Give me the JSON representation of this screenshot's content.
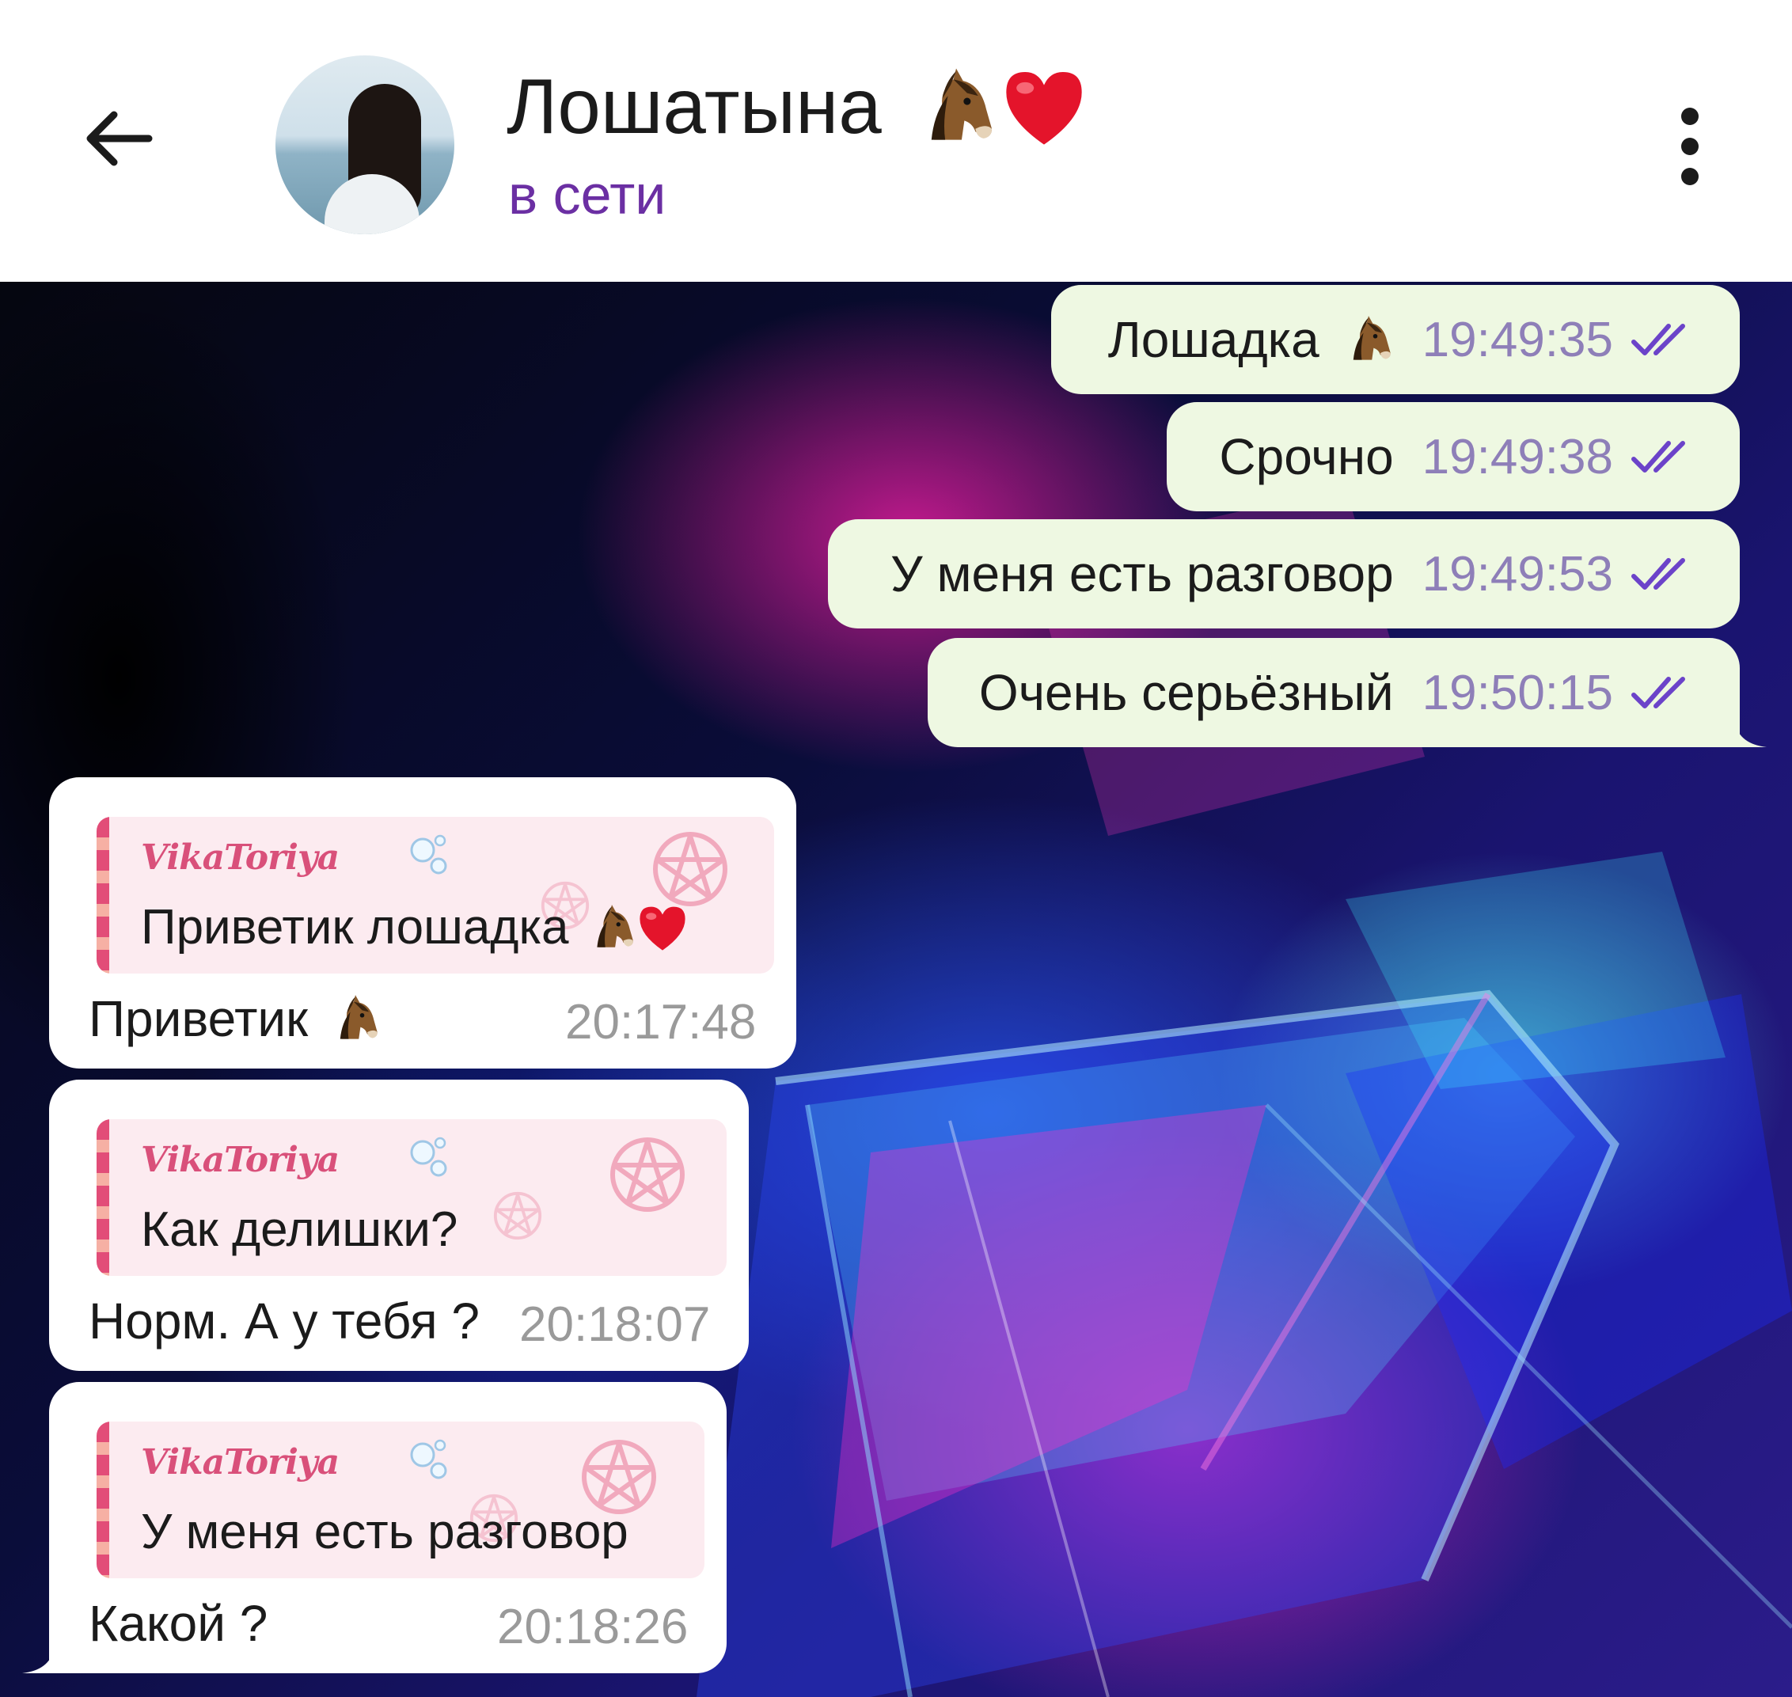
{
  "header": {
    "contact_name": "Лошатына",
    "name_emoji": [
      "horse-face-icon",
      "red-heart-icon"
    ],
    "status": "в сети",
    "status_color": "#6b2fa3"
  },
  "outgoing": [
    {
      "text": "Лошадка",
      "emoji": "horse-face-icon",
      "time": "19:49:35"
    },
    {
      "text": "Срочно",
      "time": "19:49:38"
    },
    {
      "text": "У меня есть разговор",
      "time": "19:49:53"
    },
    {
      "text": "Очень серьёзный",
      "time": "19:50:15"
    }
  ],
  "incoming": [
    {
      "quote_author": "VikaToriya",
      "quote_text": "Приветик лошадка",
      "quote_emoji": [
        "horse-face-icon",
        "red-heart-icon"
      ],
      "text": "Приветик",
      "emoji": "horse-face-icon",
      "time": "20:17:48"
    },
    {
      "quote_author": "VikaToriya",
      "quote_text": "Как делишки?",
      "text": "Норм. А у тебя ?",
      "time": "20:18:07"
    },
    {
      "quote_author": "VikaToriya",
      "quote_text": "У меня есть разговор",
      "text": "Какой ?",
      "time": "20:18:26"
    }
  ],
  "colors": {
    "outgoing_bubble": "#eef8e2",
    "incoming_bubble": "#ffffff",
    "quote_background": "#fcebf0",
    "quote_author": "#d9507a",
    "read_ticks": "#6b43c9"
  }
}
